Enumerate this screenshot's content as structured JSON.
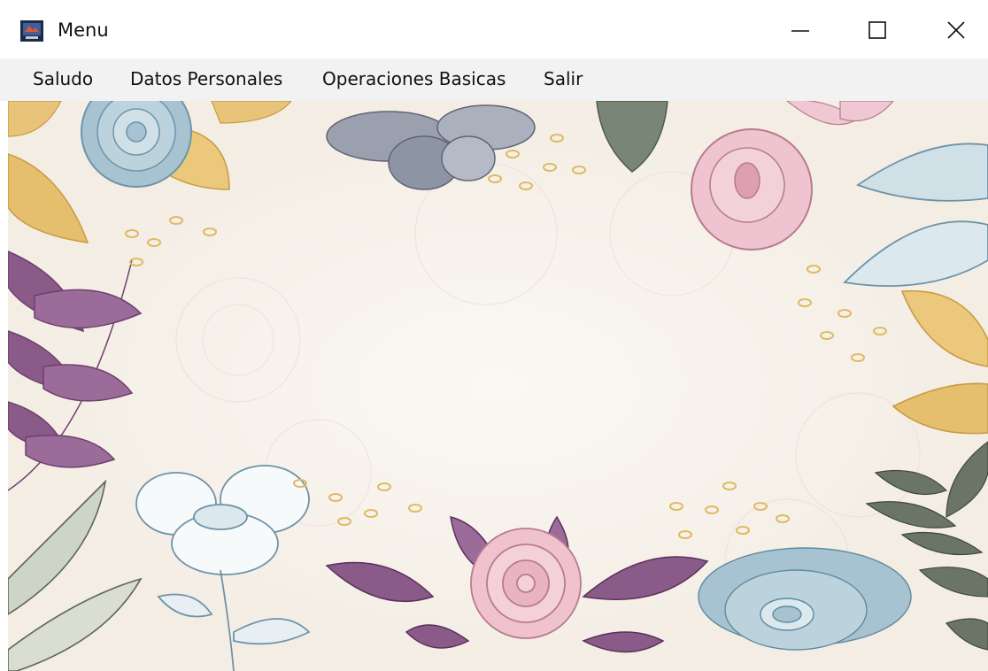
{
  "window": {
    "title": "Menu",
    "icons": {
      "app": "app-window-icon",
      "minimize": "minimize-icon",
      "maximize": "maximize-icon",
      "close": "close-icon"
    }
  },
  "menubar": {
    "items": [
      {
        "label": "Saludo"
      },
      {
        "label": "Datos Personales"
      },
      {
        "label": "Operaciones Basicas"
      },
      {
        "label": "Salir"
      }
    ]
  },
  "background": {
    "description_colors": {
      "canvas": "#f6f2ec",
      "blue": "#8fb3c4",
      "gold": "#e6bf6e",
      "purple": "#8a5a88",
      "pink": "#e9b8c6",
      "green": "#6b7566"
    }
  }
}
